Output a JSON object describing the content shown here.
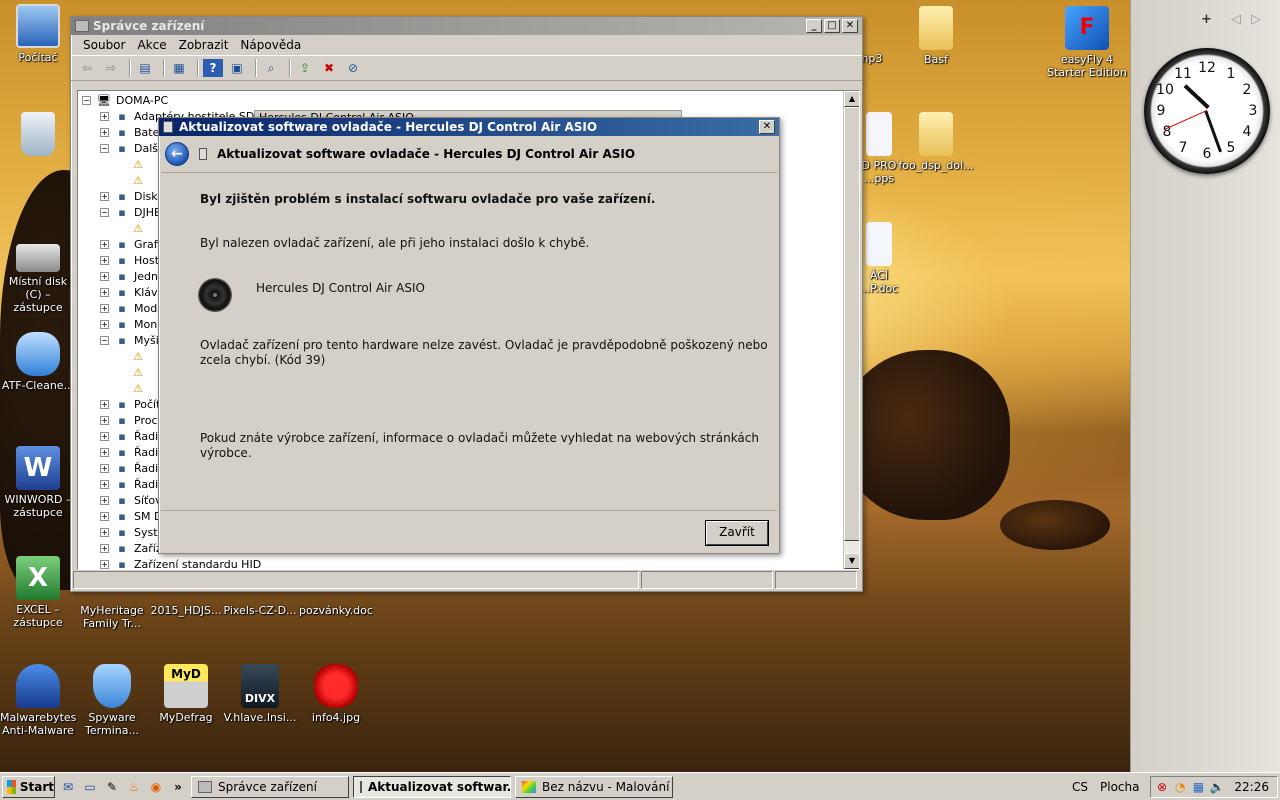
{
  "desktop": {
    "icons": [
      {
        "label": "Počítač"
      },
      {
        "label": "Koš"
      },
      {
        "label": "Místní disk (C) – zástupce"
      },
      {
        "label": "ATF-Cleane..."
      },
      {
        "label": "WINWORD – zástupce"
      },
      {
        "label": "EXCEL – zástupce"
      },
      {
        "label": "Malwarebytes Anti-Malware"
      },
      {
        "label": "Spyware Termina..."
      },
      {
        "label": "MyDefrag"
      },
      {
        "label": "V.hlave.Insi..."
      },
      {
        "label": "info4.jpg"
      },
      {
        "label": "MyHeritage Family Tr..."
      },
      {
        "label": "2015_HDJS..."
      },
      {
        "label": "Pixels-CZ-D..."
      },
      {
        "label": "pozvánky.doc"
      },
      {
        "label": "mp3"
      },
      {
        "label": "Basf"
      },
      {
        "label": "easyFly 4 Starter Edition"
      },
      {
        "label": "D PRO ...pps"
      },
      {
        "label": "foo_dsp_dol..."
      },
      {
        "label": "ÁCÍ ...P.doc"
      }
    ]
  },
  "sidebar": {
    "add": "+",
    "prev": "◁",
    "next": "▷",
    "clock_time": {
      "hour": 10,
      "minute": 26,
      "second": 41
    }
  },
  "device_manager": {
    "title": "Správce zařízení",
    "menu": [
      "Soubor",
      "Akce",
      "Zobrazit",
      "Nápověda"
    ],
    "tree": {
      "root": "DOMA-PC",
      "items": [
        "Adaptéry hostitele SD",
        "Baterie",
        "Další zařízení",
        "",
        "",
        "Diskové jednotky",
        "DJHERCULES",
        "",
        "Grafické adaptéry",
        "Hostitelské řadiče",
        "Jednotky",
        "Klávesnice",
        "Modemy",
        "Monitory",
        "Myši a jiná polohovací zařízení",
        "",
        "",
        "",
        "Počítač",
        "Procesory",
        "Řadiče",
        "Řadiče",
        "Řadiče",
        "Řadiče",
        "Síťové adaptéry",
        "SM D",
        "Systémová zařízení",
        "Zařízení",
        "Zařízení standardu HID"
      ]
    },
    "behind_dialog_text": "Hercules DJ Control Air ASIO"
  },
  "dialog": {
    "title": "Aktualizovat software ovladače - Hercules DJ Control Air ASIO",
    "header": "Aktualizovat software ovladače - Hercules DJ Control Air ASIO",
    "heading": "Byl zjištěn problém s instalací softwaru ovladače pro vaše zařízení.",
    "info": "Byl nalezen ovladač zařízení, ale při jeho instalaci došlo k chybě.",
    "device_name": "Hercules DJ Control Air ASIO",
    "error_line1": "Ovladač zařízení pro tento hardware nelze zavést. Ovladač je pravděpodobně poškozený nebo",
    "error_line2": "zcela chybí. (Kód 39)",
    "hint_line1": "Pokud znáte výrobce zařízení, informace o ovladači můžete vyhledat na webových stránkách",
    "hint_line2": "výrobce.",
    "close_label": "Zavřít"
  },
  "taskbar": {
    "start_label": "Start",
    "quick_more": "»",
    "tasks": [
      {
        "label": "Správce zařízení"
      },
      {
        "label": "Aktualizovat softwar..."
      },
      {
        "label": "Bez názvu - Malování"
      }
    ],
    "language": "CS",
    "desktop_label": "Plocha",
    "time": "22:26"
  }
}
